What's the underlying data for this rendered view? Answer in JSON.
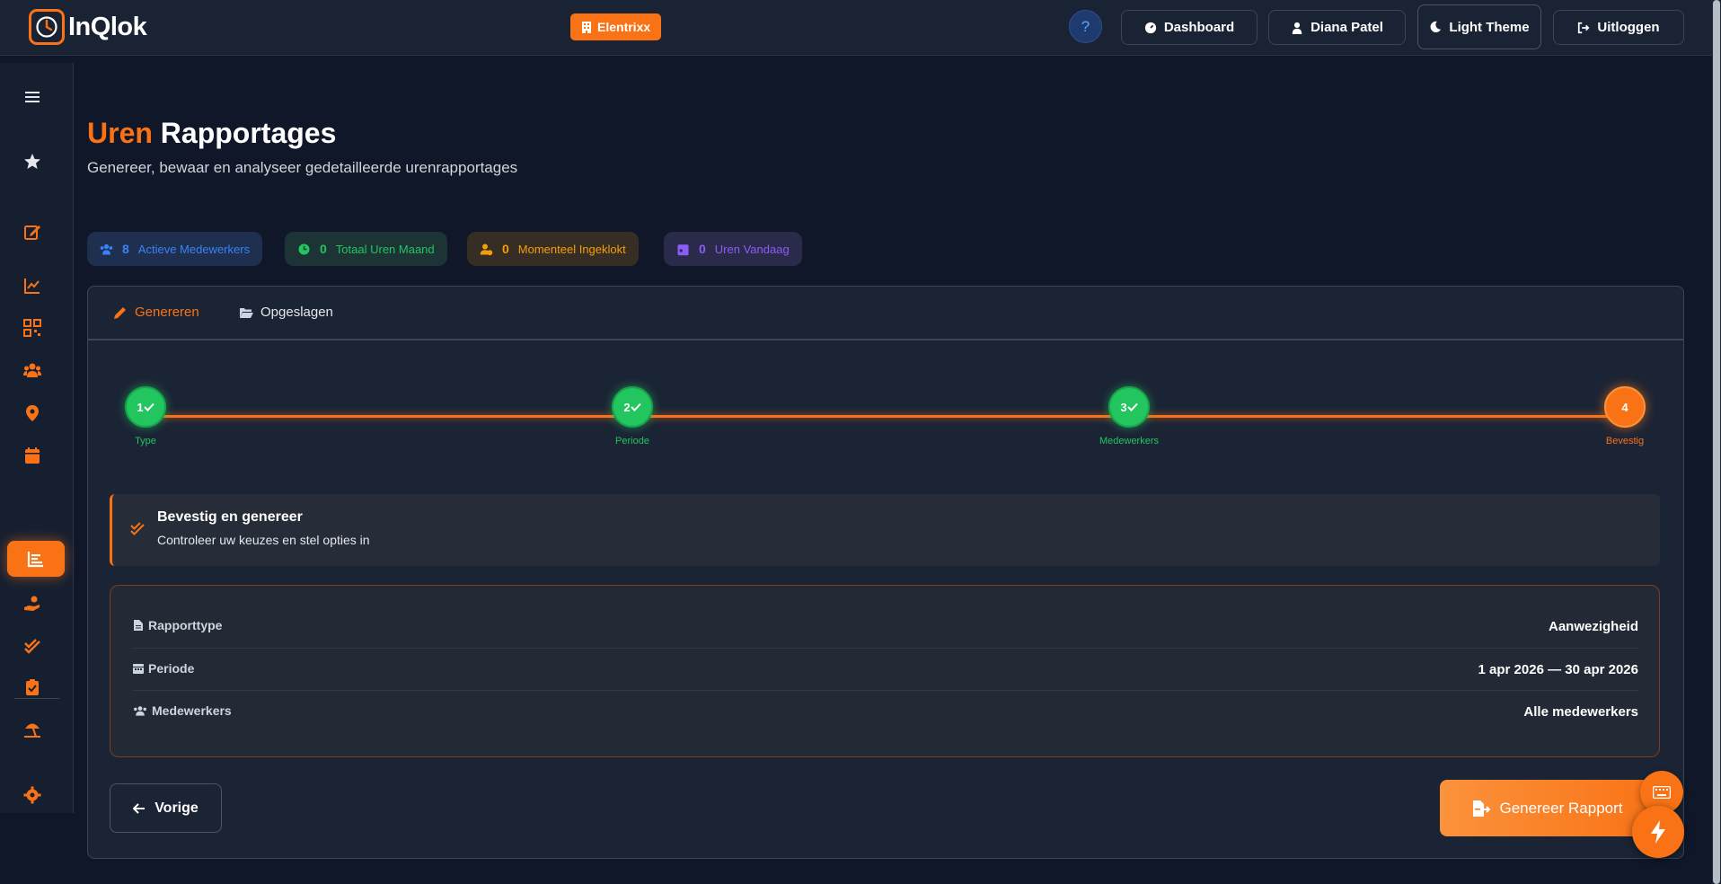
{
  "app": {
    "logo_text": "InQlok",
    "company": "Elentrixx"
  },
  "topnav": {
    "help": "?",
    "dashboard": "Dashboard",
    "user": "Diana Patel",
    "theme": "Light Theme",
    "logout": "Uitloggen"
  },
  "header": {
    "title_accent": "Uren",
    "title_rest": "Rapportages",
    "subtitle": "Genereer, bewaar en analyseer gedetailleerde urenrapportages"
  },
  "stats": [
    {
      "value": "8",
      "label": "Actieve Medewerkers",
      "color": "#3b82f6",
      "bg": "#1e2f4f"
    },
    {
      "value": "0",
      "label": "Totaal Uren Maand",
      "color": "#22c55e",
      "bg": "#1d3436"
    },
    {
      "value": "0",
      "label": "Momenteel Ingeklokt",
      "color": "#f59e0b",
      "bg": "#362d25"
    },
    {
      "value": "0",
      "label": "Uren Vandaag",
      "color": "#8b5cf6",
      "bg": "#2a2a4a"
    }
  ],
  "tabs": [
    {
      "label": "Genereren",
      "active": true
    },
    {
      "label": "Opgeslagen",
      "active": false
    }
  ],
  "steps": [
    {
      "num": "1",
      "label": "Type",
      "state": "done"
    },
    {
      "num": "2",
      "label": "Periode",
      "state": "done"
    },
    {
      "num": "3",
      "label": "Medewerkers",
      "state": "done"
    },
    {
      "num": "4",
      "label": "Bevestig",
      "state": "current"
    }
  ],
  "confirm": {
    "title": "Bevestig en genereer",
    "subtitle": "Controleer uw keuzes en stel opties in"
  },
  "summary": [
    {
      "label": "Rapporttype",
      "value": "Aanwezigheid",
      "icon": "file-icon"
    },
    {
      "label": "Periode",
      "value": "1 apr 2026 — 30 apr 2026",
      "icon": "calendar-icon"
    },
    {
      "label": "Medewerkers",
      "value": "Alle medewerkers",
      "icon": "users-icon"
    }
  ],
  "buttons": {
    "prev": "Vorige",
    "generate": "Genereer Rapport"
  },
  "colors": {
    "accent": "#f97316",
    "success": "#22c55e",
    "background": "#0f1729"
  }
}
